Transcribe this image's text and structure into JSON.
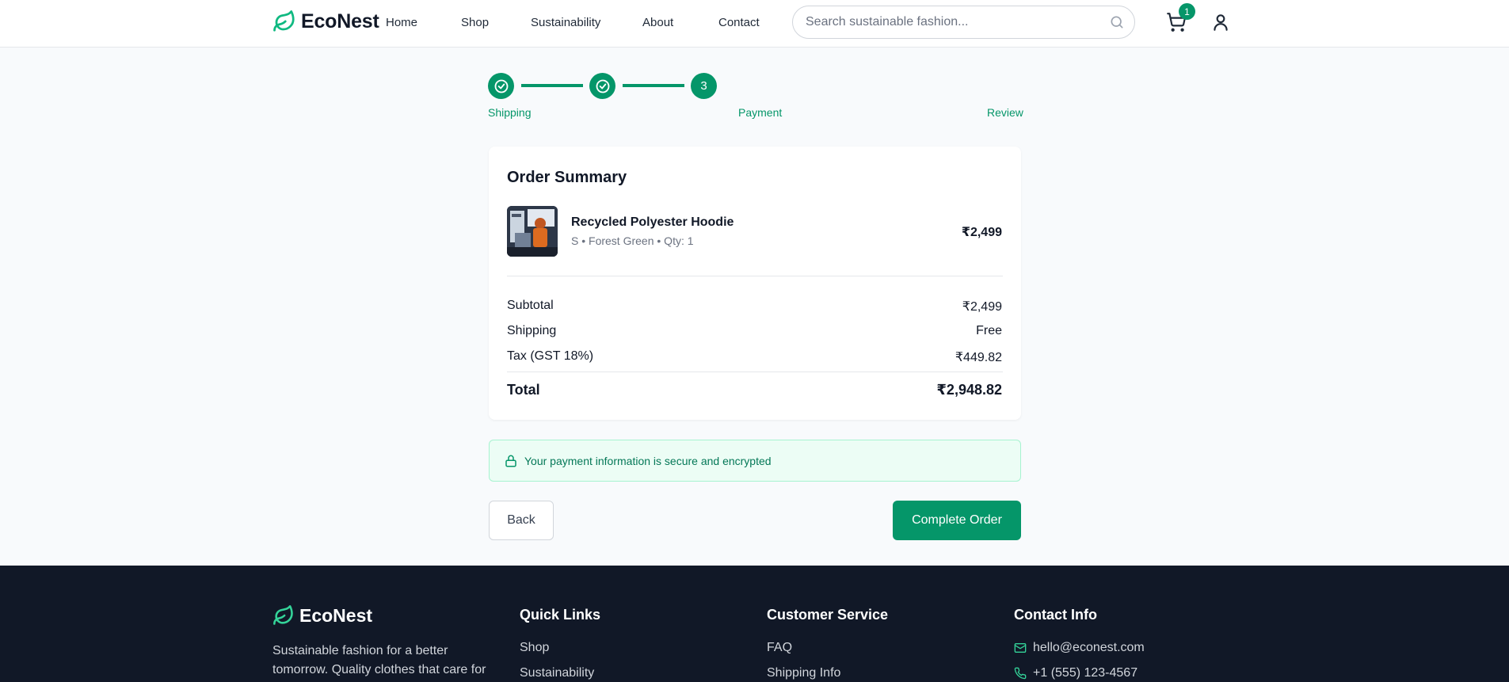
{
  "header": {
    "brand": "EcoNest",
    "nav": [
      {
        "label": "Home"
      },
      {
        "label": "Shop"
      },
      {
        "label": "Sustainability"
      },
      {
        "label": "About"
      },
      {
        "label": "Contact"
      }
    ],
    "search_placeholder": "Search sustainable fashion...",
    "cart_count": "1"
  },
  "stepper": {
    "current_step": "3",
    "labels": [
      "Shipping",
      "Payment",
      "Review"
    ]
  },
  "summary": {
    "title": "Order Summary",
    "item": {
      "name": "Recycled Polyester Hoodie",
      "meta": "S • Forest Green • Qty: 1",
      "price": "₹2,499"
    },
    "rows": [
      {
        "label": "Subtotal",
        "value": "₹2,499"
      },
      {
        "label": "Shipping",
        "value": "Free"
      },
      {
        "label": "Tax (GST 18%)",
        "value": "₹449.82"
      }
    ],
    "total_label": "Total",
    "total_value": "₹2,948.82"
  },
  "secure_notice": "Your payment information is secure and encrypted",
  "buttons": {
    "back": "Back",
    "complete": "Complete Order"
  },
  "footer": {
    "brand": "EcoNest",
    "description": "Sustainable fashion for a better tomorrow. Quality clothes that care for",
    "quick_links_title": "Quick Links",
    "quick_links": [
      "Shop",
      "Sustainability"
    ],
    "customer_service_title": "Customer Service",
    "customer_service": [
      "FAQ",
      "Shipping Info"
    ],
    "contact_title": "Contact Info",
    "email": "hello@econest.com",
    "phone": "+1 (555) 123-4567"
  },
  "colors": {
    "accent": "#059669",
    "footer_bg": "#111827",
    "page_bg": "#f8fafc"
  }
}
